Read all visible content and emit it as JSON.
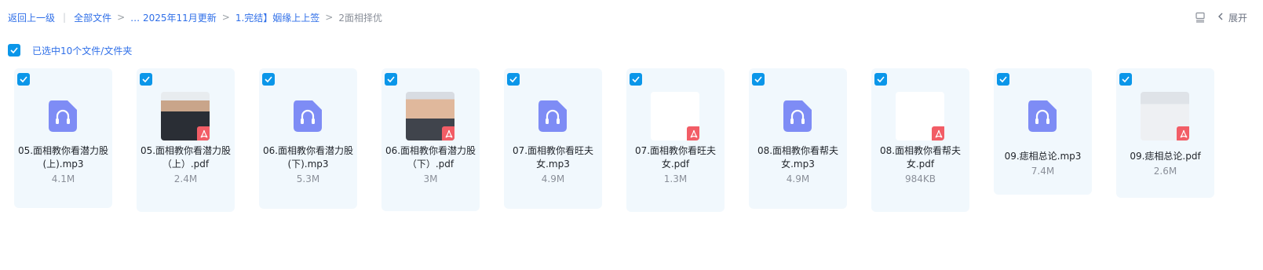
{
  "breadcrumb": {
    "back": "返回上一级",
    "all_files": "全部文件",
    "ellipsis_folder": "… 2025年11月更新",
    "folder2": "1.完结】姻缘上上签",
    "current": "2面相择优"
  },
  "toolbar": {
    "expand_label": "展开"
  },
  "selection": {
    "label": "已选中10个文件/文件夹"
  },
  "colors": {
    "accent": "#0b96e9",
    "link": "#2f6fe8",
    "audio_icon": "#7e8cf5",
    "pdf_badge": "#f25d66",
    "card_bg": "#f1f8fd"
  },
  "files": [
    {
      "name": "05.面相教你看潜力股(上).mp3",
      "size": "4.1M",
      "type": "audio"
    },
    {
      "name": "05.面相教你看潜力股（上）.pdf",
      "size": "2.4M",
      "type": "pdf"
    },
    {
      "name": "06.面相教你看潜力股(下).mp3",
      "size": "5.3M",
      "type": "audio"
    },
    {
      "name": "06.面相教你看潜力股（下）.pdf",
      "size": "3M",
      "type": "pdf"
    },
    {
      "name": "07.面相教你看旺夫女.mp3",
      "size": "4.9M",
      "type": "audio"
    },
    {
      "name": "07.面相教你看旺夫女.pdf",
      "size": "1.3M",
      "type": "pdf"
    },
    {
      "name": "08.面相教你看帮夫女.mp3",
      "size": "4.9M",
      "type": "audio"
    },
    {
      "name": "08.面相教你看帮夫女.pdf",
      "size": "984KB",
      "type": "pdf"
    },
    {
      "name": "09.痣相总论.mp3",
      "size": "7.4M",
      "type": "audio"
    },
    {
      "name": "09.痣相总论.pdf",
      "size": "2.6M",
      "type": "pdf"
    }
  ]
}
